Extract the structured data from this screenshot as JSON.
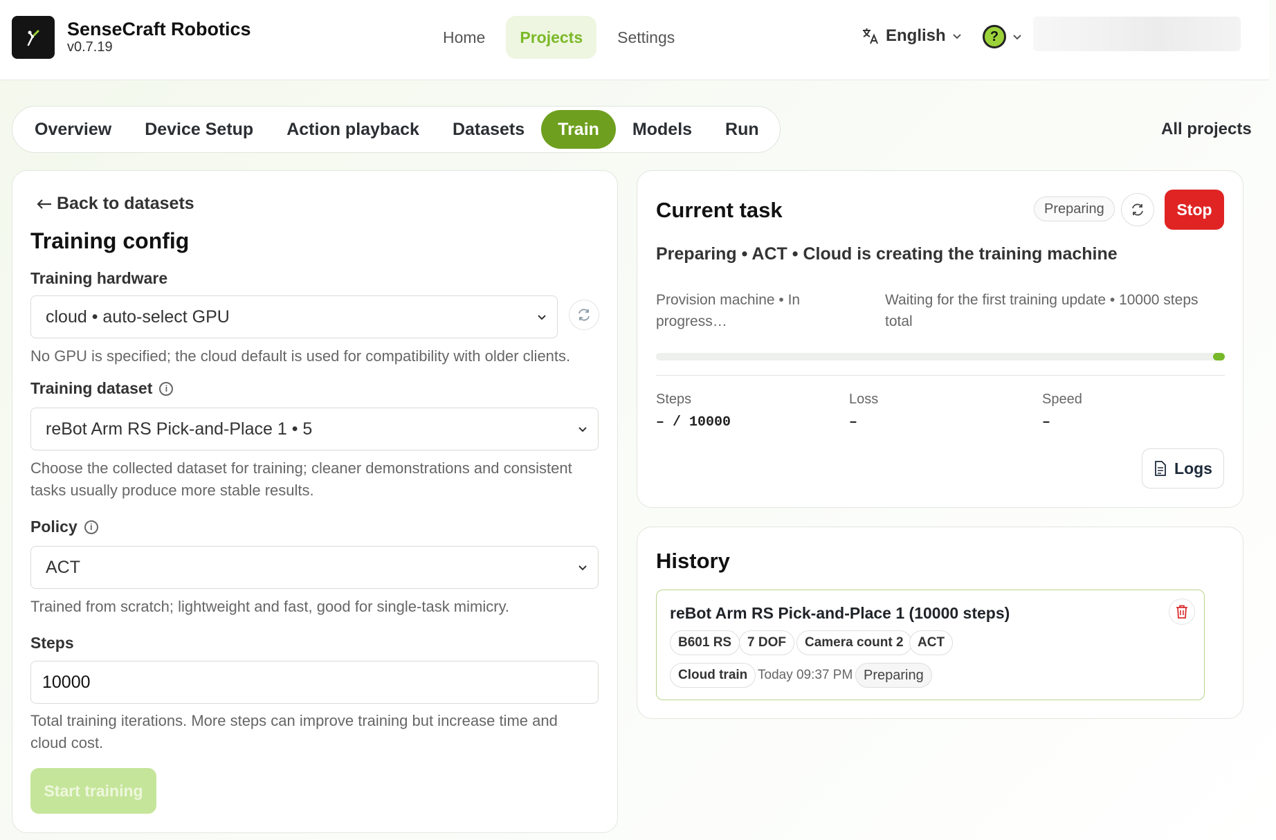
{
  "brand": {
    "name": "SenseCraft Robotics",
    "version": "v0.7.19"
  },
  "nav": {
    "items": [
      {
        "label": "Home"
      },
      {
        "label": "Projects"
      },
      {
        "label": "Settings"
      }
    ],
    "active": "Projects"
  },
  "language": {
    "label": "English"
  },
  "help": {
    "glyph": "?"
  },
  "tabs": {
    "items": [
      {
        "label": "Overview"
      },
      {
        "label": "Device Setup"
      },
      {
        "label": "Action playback"
      },
      {
        "label": "Datasets"
      },
      {
        "label": "Train"
      },
      {
        "label": "Models"
      },
      {
        "label": "Run"
      }
    ],
    "active": "Train",
    "all_projects": "All projects"
  },
  "config": {
    "back_label": "Back to datasets",
    "title": "Training config",
    "hardware": {
      "label": "Training hardware",
      "value": "cloud  •  auto-select GPU",
      "help": "No GPU is specified; the cloud default is used for compatibility with older clients."
    },
    "dataset": {
      "label": "Training dataset",
      "value": "reBot Arm RS Pick-and-Place 1  •  5",
      "help_line1": "Choose the collected dataset for training; cleaner demonstrations and consistent",
      "help_line2": "tasks usually produce more stable results."
    },
    "policy": {
      "label": "Policy",
      "value": "ACT",
      "help": "Trained from scratch; lightweight and fast, good for single-task mimicry."
    },
    "steps": {
      "label": "Steps",
      "value": "10000",
      "help_line1": "Total training iterations. More steps can improve training but increase time and",
      "help_line2": "cloud cost."
    },
    "start_label": "Start training"
  },
  "task": {
    "title": "Current task",
    "status": "Preparing",
    "stop_label": "Stop",
    "summary": "Preparing  •  ACT  •  Cloud is creating the training machine",
    "left_line1": "Provision machine  •  In",
    "left_line2": "progress…",
    "right_line1": "Waiting for the first training update  •  10000 steps",
    "right_line2": "total",
    "progress": 0.0,
    "stats": {
      "steps_label": "Steps",
      "steps_value": "– / 10000",
      "loss_label": "Loss",
      "loss_value": "–",
      "speed_label": "Speed",
      "speed_value": "–"
    },
    "logs_label": "Logs"
  },
  "history": {
    "title": "History",
    "items": [
      {
        "title": "reBot Arm RS Pick-and-Place 1 (10000 steps)",
        "chips": [
          "B601 RS",
          "7 DOF",
          "Camera count 2",
          "ACT"
        ],
        "mode": "Cloud train",
        "time": "Today 09:37 PM",
        "status": "Preparing"
      }
    ]
  },
  "colors": {
    "accent": "#6e9f1e",
    "accent_light": "#c5e59a",
    "danger": "#e02424",
    "nav_active": "#7bb928"
  },
  "icons": [
    "robot-logo-icon",
    "translate-icon",
    "chevron-down-icon",
    "help-icon",
    "arrow-left-icon",
    "refresh-icon",
    "info-icon",
    "file-icon",
    "trash-icon"
  ]
}
